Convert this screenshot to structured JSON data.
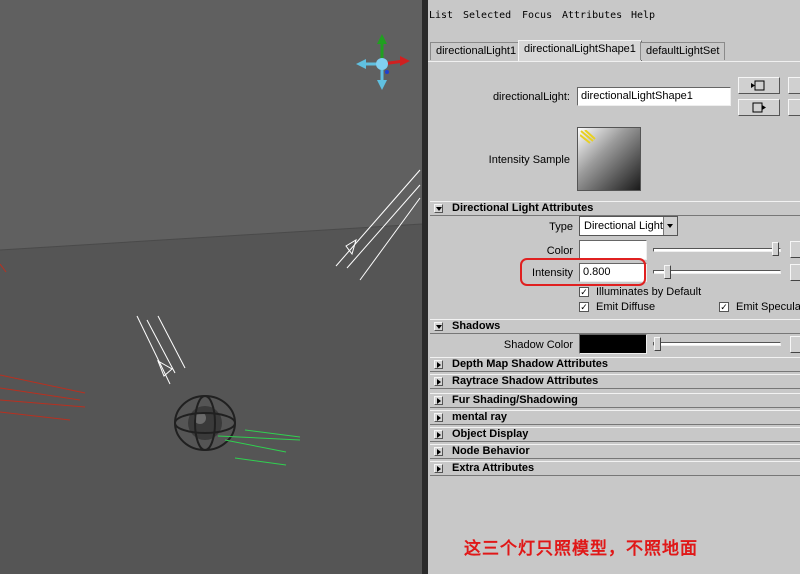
{
  "menubar": {
    "items": [
      "List",
      "Selected",
      "Focus",
      "Attributes",
      "Help"
    ]
  },
  "tabs": [
    {
      "label": "directionalLight1",
      "active": false
    },
    {
      "label": "directionalLightShape1",
      "active": true
    },
    {
      "label": "defaultLightSet",
      "active": false
    }
  ],
  "node": {
    "label": "directionalLight:",
    "value": "directionalLightShape1"
  },
  "intensity_sample": {
    "label": "Intensity Sample"
  },
  "sections": {
    "directional": {
      "title": "Directional Light Attributes",
      "expanded": true
    },
    "shadows": {
      "title": "Shadows",
      "expanded": true
    },
    "collapsed": [
      "Depth Map Shadow Attributes",
      "Raytrace Shadow Attributes",
      "Fur Shading/Shadowing",
      "mental ray",
      "Object Display",
      "Node Behavior",
      "Extra Attributes"
    ]
  },
  "attributes": {
    "type_label": "Type",
    "type_value": "Directional Light",
    "color_label": "Color",
    "color_value": "#ffffff",
    "intensity_label": "Intensity",
    "intensity_value": "0.800",
    "illuminates_label": "Illuminates by Default",
    "emit_diffuse_label": "Emit Diffuse",
    "emit_specular_label": "Emit Specular",
    "illuminates_checked": true,
    "emit_diffuse_checked": true,
    "emit_specular_checked": true
  },
  "shadows": {
    "color_label": "Shadow Color",
    "color_value": "#000000"
  },
  "annotation": {
    "text": "这三个灯只照模型，不照地面",
    "color": "#e01818"
  },
  "viewport": {
    "axis_colors": {
      "x": "#d02020",
      "y": "#20a020",
      "z": "#2040d0"
    }
  }
}
